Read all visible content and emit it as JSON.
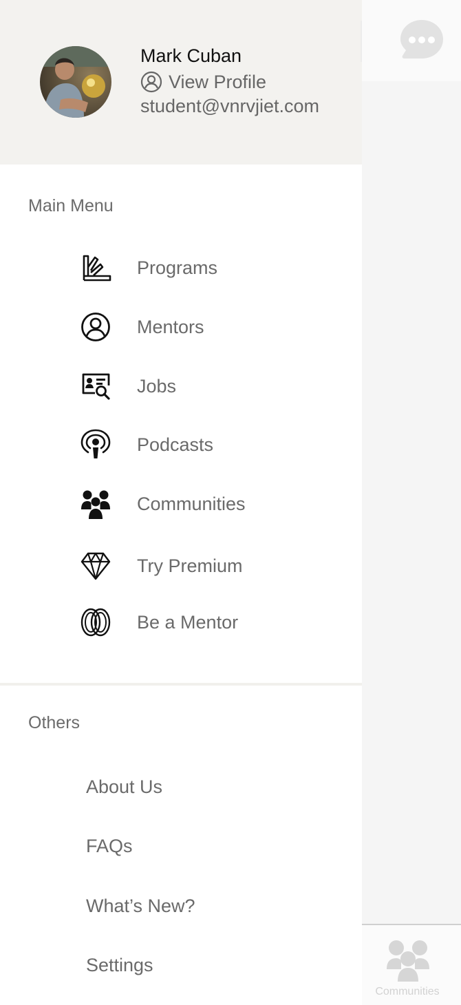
{
  "background": {
    "chat_icon": "chat-bubble-icon",
    "tab_label": "Communities",
    "tab_icon": "communities-icon"
  },
  "profile": {
    "name": "Mark Cuban",
    "view_profile_label": "View Profile",
    "email": "student@vnrvjiet.com"
  },
  "main_menu": {
    "title": "Main Menu",
    "items": [
      {
        "label": "Programs",
        "icon": "programs-icon"
      },
      {
        "label": "Mentors",
        "icon": "user-circle-icon"
      },
      {
        "label": "Jobs",
        "icon": "job-search-icon"
      },
      {
        "label": "Podcasts",
        "icon": "podcast-icon"
      },
      {
        "label": "Communities",
        "icon": "communities-icon"
      },
      {
        "label": "Try Premium",
        "icon": "diamond-icon"
      },
      {
        "label": "Be a Mentor",
        "icon": "interlinked-rings-icon"
      }
    ]
  },
  "others": {
    "title": "Others",
    "items": [
      {
        "label": "About Us"
      },
      {
        "label": "FAQs"
      },
      {
        "label": "What’s New?"
      },
      {
        "label": "Settings"
      }
    ]
  }
}
